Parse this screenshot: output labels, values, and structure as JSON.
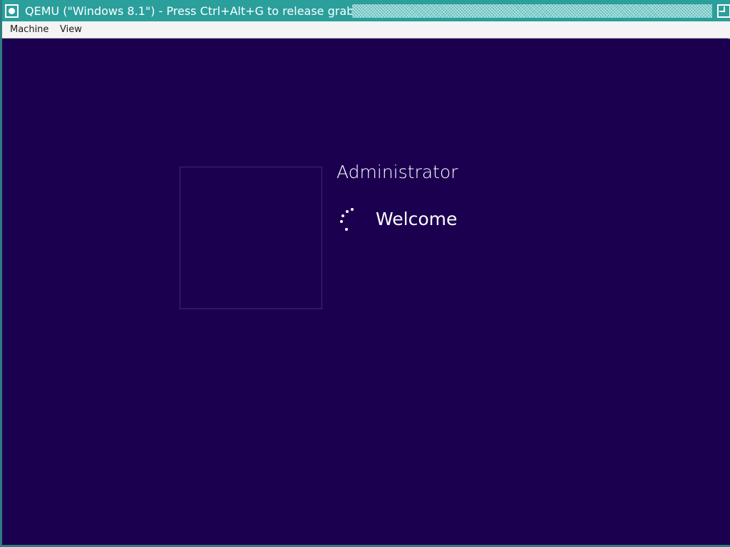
{
  "window": {
    "title": "QEMU (\"Windows 8.1\") - Press Ctrl+Alt+G to release grab",
    "title_bar_color": "#2a9f9c"
  },
  "menubar": {
    "items": [
      {
        "label": "Machine"
      },
      {
        "label": "View"
      }
    ]
  },
  "guest_screen": {
    "background_color": "#1c0050",
    "user_tile_icon": "user-picture-placeholder",
    "username": "Administrator",
    "status": "Welcome",
    "spinner_icon": "loading-spinner-icon"
  }
}
